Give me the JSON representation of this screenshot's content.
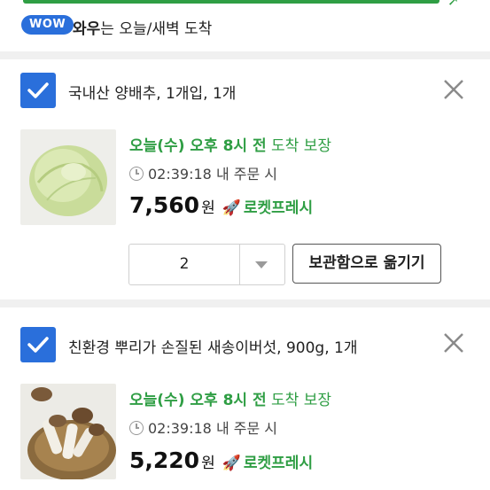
{
  "wow": {
    "badge": "WOW",
    "text_bold": "와우",
    "text_rest": "는 오늘/새벽 도착"
  },
  "items": [
    {
      "title": "국내산 양배추, 1개입, 1개",
      "arrival_highlight": "오늘(수) 오후 8시 전",
      "arrival_rest": "도착 보장",
      "order_time": "02:39:18 내 주문 시",
      "price": "7,560",
      "currency": "원",
      "badge": "로켓프레시",
      "quantity": "2",
      "move_button": "보관함으로 옮기기"
    },
    {
      "title": "친환경 뿌리가 손질된 새송이버섯, 900g, 1개",
      "arrival_highlight": "오늘(수) 오후 8시 전",
      "arrival_rest": "도착 보장",
      "order_time": "02:39:18 내 주문 시",
      "price": "5,220",
      "currency": "원",
      "badge": "로켓프레시"
    }
  ],
  "colors": {
    "accent_blue": "#2a6fdb",
    "rocket_green": "#2f9e44"
  }
}
